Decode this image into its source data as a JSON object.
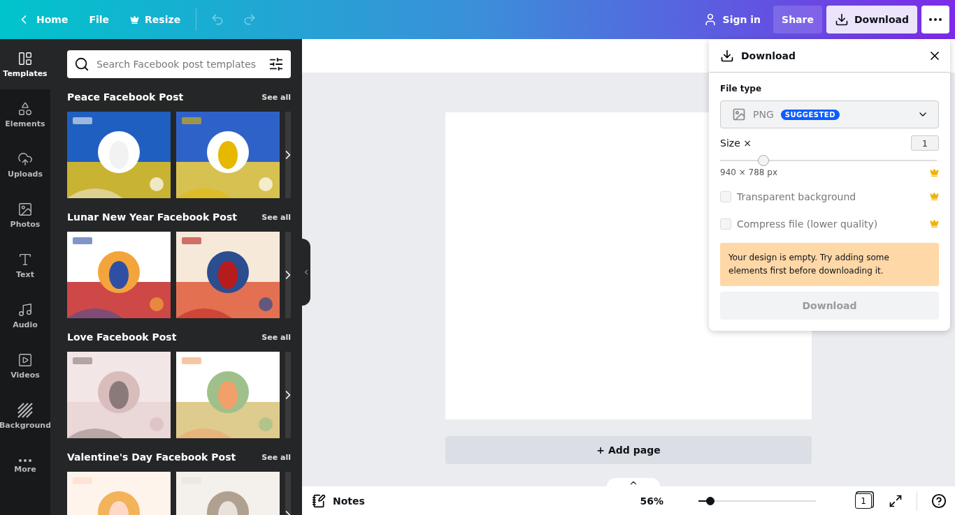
{
  "topbar": {
    "back": "Home",
    "menu": [
      "File",
      "Resize"
    ],
    "undo": {
      "disabled": true
    },
    "redo": {
      "disabled": true
    },
    "sign_in": "Sign in",
    "share": "Share",
    "download": "Download"
  },
  "rail": [
    {
      "label": "Templates",
      "selected": true
    },
    {
      "label": "Elements",
      "selected": false
    },
    {
      "label": "Uploads",
      "selected": false
    },
    {
      "label": "Photos",
      "selected": false
    },
    {
      "label": "Text",
      "selected": false
    },
    {
      "label": "Audio",
      "selected": false
    },
    {
      "label": "Videos",
      "selected": false
    },
    {
      "label": "Background",
      "selected": false
    },
    {
      "label": "More",
      "selected": false
    }
  ],
  "search": {
    "placeholder": "Search Facebook post templates"
  },
  "sections": [
    {
      "title": "Peace Facebook Post",
      "see_all": "See all"
    },
    {
      "title": "Lunar New Year Facebook Post",
      "see_all": "See all"
    },
    {
      "title": "Love Facebook Post",
      "see_all": "See all"
    },
    {
      "title": "Valentine's Day Facebook Post",
      "see_all": "See all"
    }
  ],
  "canvas": {
    "add_page": "+ Add page"
  },
  "bottom": {
    "notes": "Notes",
    "zoom": "56%",
    "zoom_slider": {
      "level": 0.1
    },
    "pages": "1"
  },
  "download_panel": {
    "title": "Download",
    "file_type_label": "File type",
    "file_type": "PNG",
    "badge": "SUGGESTED",
    "size_label": "Size ×",
    "size_value": "1",
    "size_slider": {
      "level": 0.2
    },
    "dimensions": "940 × 788 px",
    "options": [
      {
        "label": "Transparent background",
        "checked": false
      },
      {
        "label": "Compress file (lower quality)",
        "checked": false
      }
    ],
    "notice": "Your design is empty. Try adding some elements first before downloading it.",
    "button": {
      "label": "Download",
      "disabled": true
    }
  }
}
